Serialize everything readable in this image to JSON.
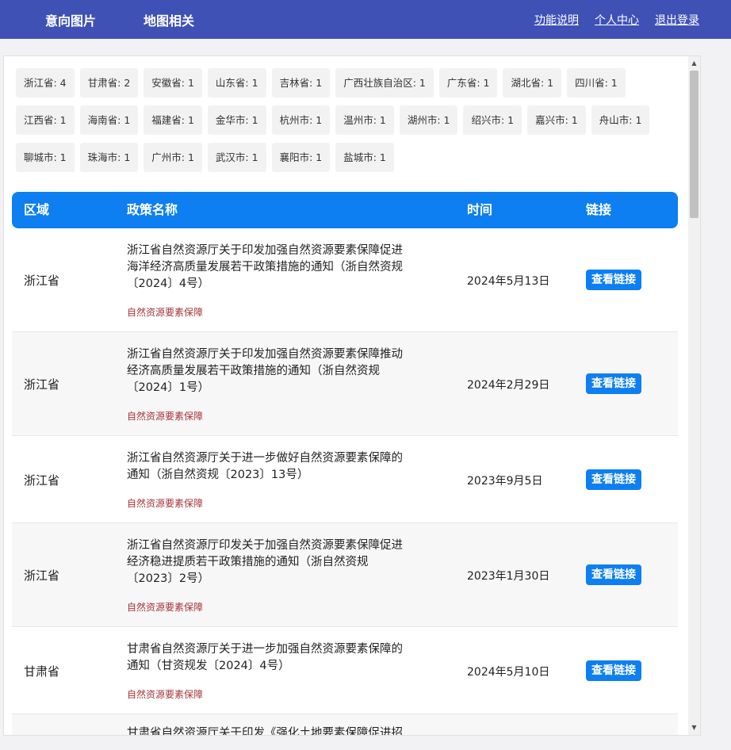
{
  "nav": {
    "left": [
      "意向图片",
      "地图相关"
    ],
    "right": [
      "功能说明",
      "个人中心",
      "退出登录"
    ]
  },
  "tags": [
    "浙江省: 4",
    "甘肃省: 2",
    "安徽省: 1",
    "山东省: 1",
    "吉林省: 1",
    "广西壮族自治区: 1",
    "广东省: 1",
    "湖北省: 1",
    "四川省: 1",
    "江西省: 1",
    "海南省: 1",
    "福建省: 1",
    "金华市: 1",
    "杭州市: 1",
    "温州市: 1",
    "湖州市: 1",
    "绍兴市: 1",
    "嘉兴市: 1",
    "舟山市: 1",
    "聊城市: 1",
    "珠海市: 1",
    "广州市: 1",
    "武汉市: 1",
    "襄阳市: 1",
    "盐城市: 1"
  ],
  "table": {
    "headers": {
      "region": "区域",
      "name": "政策名称",
      "time": "时间",
      "link": "链接"
    },
    "rows": [
      {
        "region": "浙江省",
        "title_lines": [
          "浙江省自然资源厅关于印发加强自然资源要素保障促进",
          "海洋经济高质量发展若干政策措施的通知（浙自然资规",
          "〔2024〕4号）"
        ],
        "tag": "自然资源要素保障",
        "date": "2024年5月13日",
        "link": "查看链接"
      },
      {
        "region": "浙江省",
        "title_lines": [
          "浙江省自然资源厅关于印发加强自然资源要素保障推动",
          "经济高质量发展若干政策措施的通知（浙自然资规",
          "〔2024〕1号）"
        ],
        "tag": "自然资源要素保障",
        "date": "2024年2月29日",
        "link": "查看链接"
      },
      {
        "region": "浙江省",
        "title_lines": [
          "浙江省自然资源厅关于进一步做好自然资源要素保障的",
          "通知（浙自然资规〔2023〕13号）"
        ],
        "tag": "自然资源要素保障",
        "date": "2023年9月5日",
        "link": "查看链接"
      },
      {
        "region": "浙江省",
        "title_lines": [
          "浙江省自然资源厅印发关于加强自然资源要素保障促进",
          "经济稳进提质若干政策措施的通知（浙自然资规",
          "〔2023〕2号）"
        ],
        "tag": "自然资源要素保障",
        "date": "2023年1月30日",
        "link": "查看链接"
      },
      {
        "region": "甘肃省",
        "title_lines": [
          "甘肃省自然资源厅关于进一步加强自然资源要素保障的",
          "通知（甘资规发〔2024〕4号）"
        ],
        "tag": "自然资源要素保障",
        "date": "2024年5月10日",
        "link": "查看链接"
      },
      {
        "region": "",
        "title_lines": [
          "甘肃省自然资源厅关于印发《强化土地要素保障促进招"
        ],
        "tag": "",
        "date": "",
        "link": ""
      }
    ]
  }
}
